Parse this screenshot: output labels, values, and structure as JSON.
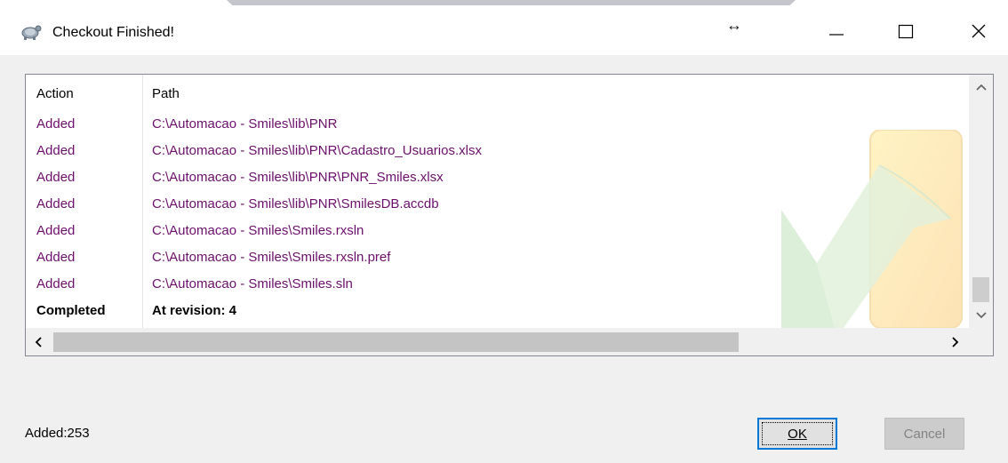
{
  "window": {
    "title": "Checkout Finished!",
    "resize_cursor": "↔",
    "controls": [
      "minimize-icon",
      "maximize-icon",
      "close-icon"
    ]
  },
  "list": {
    "columns": {
      "action": "Action",
      "path": "Path"
    },
    "rows": [
      {
        "action": "Added",
        "path": "C:\\Automacao - Smiles\\lib\\PNR"
      },
      {
        "action": "Added",
        "path": "C:\\Automacao - Smiles\\lib\\PNR\\Cadastro_Usuarios.xlsx"
      },
      {
        "action": "Added",
        "path": "C:\\Automacao - Smiles\\lib\\PNR\\PNR_Smiles.xlsx"
      },
      {
        "action": "Added",
        "path": "C:\\Automacao - Smiles\\lib\\PNR\\SmilesDB.accdb"
      },
      {
        "action": "Added",
        "path": "C:\\Automacao - Smiles\\Smiles.rxsln"
      },
      {
        "action": "Added",
        "path": "C:\\Automacao - Smiles\\Smiles.rxsln.pref"
      },
      {
        "action": "Added",
        "path": "C:\\Automacao - Smiles\\Smiles.sln"
      },
      {
        "action": "Completed",
        "path": "At revision: 4"
      }
    ]
  },
  "status": {
    "text": "Added:253"
  },
  "buttons": {
    "ok": "OK",
    "cancel": "Cancel"
  },
  "colors": {
    "added_text": "#6b0f6b",
    "accent": "#0078d7",
    "disabled_text": "#838383"
  }
}
